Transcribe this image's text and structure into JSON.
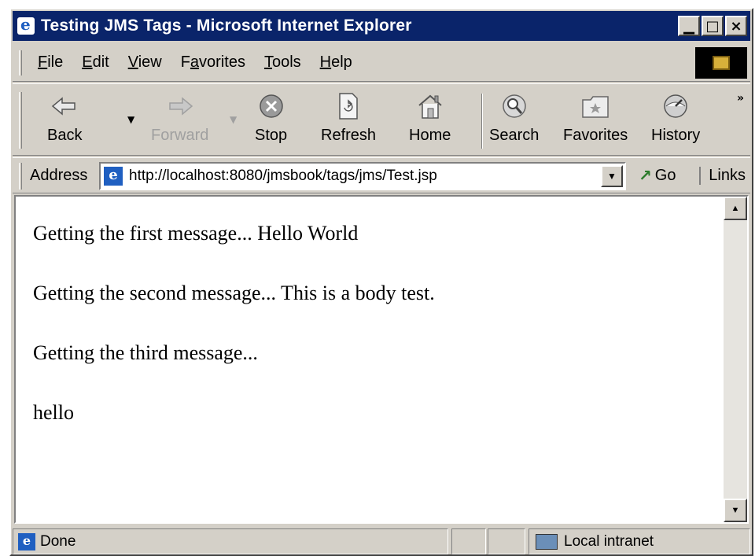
{
  "window": {
    "title": "Testing JMS Tags - Microsoft Internet Explorer",
    "buttons": {
      "minimize": "▁",
      "maximize": "□",
      "close": "×"
    }
  },
  "menu": {
    "items": [
      {
        "label": "File",
        "accel": "F",
        "rest": "ile"
      },
      {
        "label": "Edit",
        "accel": "E",
        "rest": "dit"
      },
      {
        "label": "View",
        "accel": "V",
        "rest": "iew"
      },
      {
        "label": "Favorites",
        "accel": "a",
        "pre": "F",
        "rest": "vorites"
      },
      {
        "label": "Tools",
        "accel": "T",
        "rest": "ools"
      },
      {
        "label": "Help",
        "accel": "H",
        "rest": "elp"
      }
    ]
  },
  "toolbar": {
    "back": "Back",
    "forward": "Forward",
    "stop": "Stop",
    "refresh": "Refresh",
    "home": "Home",
    "search": "Search",
    "favorites": "Favorites",
    "history": "History",
    "more": "»"
  },
  "address": {
    "label": "Address",
    "url": "http://localhost:8080/jmsbook/tags/jms/Test.jsp",
    "go": "Go",
    "links": "Links"
  },
  "content": {
    "lines": [
      "Getting the first message... Hello World",
      "Getting the second message... This is a body test.",
      "Getting the third message...",
      "hello"
    ]
  },
  "status": {
    "text": "Done",
    "zone": "Local intranet"
  }
}
